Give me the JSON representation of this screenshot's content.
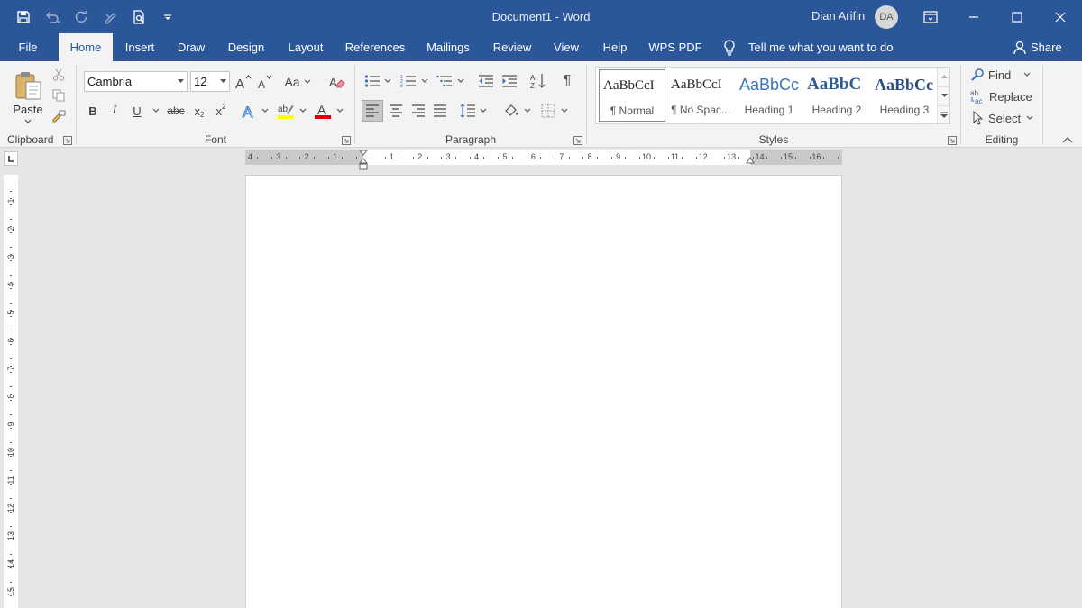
{
  "window": {
    "title": "Document1  -  Word",
    "user_name": "Dian Arifin",
    "user_initials": "DA"
  },
  "quick_access": [
    "save-icon",
    "undo-icon",
    "redo-icon",
    "touch-mode-icon",
    "print-preview-icon",
    "customize-qat-icon"
  ],
  "tabs": {
    "file": "File",
    "home": "Home",
    "insert": "Insert",
    "draw": "Draw",
    "design": "Design",
    "layout": "Layout",
    "references": "References",
    "mailings": "Mailings",
    "review": "Review",
    "view": "View",
    "help": "Help",
    "wps_pdf": "WPS PDF"
  },
  "tell_me": "Tell me what you want to do",
  "share": "Share",
  "clipboard": {
    "label": "Clipboard",
    "paste": "Paste"
  },
  "font": {
    "label": "Font",
    "name": "Cambria",
    "size": "12",
    "change_case": "Aa",
    "bold": "B",
    "italic": "I",
    "underline": "U",
    "strikethrough": "abc",
    "subscript": "x",
    "subscript_mark": "2",
    "superscript": "x",
    "superscript_mark": "2",
    "highlight_color": "#ffff00",
    "font_color": "#e00000"
  },
  "paragraph": {
    "label": "Paragraph",
    "pilcrow": "¶"
  },
  "styles": {
    "label": "Styles",
    "items": [
      {
        "sample": "AaBbCcI",
        "name": "¶ Normal"
      },
      {
        "sample": "AaBbCcI",
        "name": "¶ No Spac..."
      },
      {
        "sample": "AaBbCc",
        "name": "Heading 1"
      },
      {
        "sample": "AaBbC",
        "name": "Heading 2"
      },
      {
        "sample": "AaBbCc",
        "name": "Heading 3"
      }
    ]
  },
  "editing": {
    "label": "Editing",
    "find": "Find",
    "replace": "Replace",
    "select": "Select"
  },
  "ruler": {
    "h_left_numbers": [
      "4",
      "3",
      "2",
      "1"
    ],
    "h_right_numbers": [
      "1",
      "2",
      "3",
      "4",
      "5",
      "6",
      "7",
      "8",
      "9",
      "10",
      "11",
      "12",
      "13",
      "14",
      "15",
      "16"
    ],
    "v_numbers": [
      "1",
      "2",
      "3",
      "4",
      "5",
      "6",
      "7",
      "8",
      "9",
      "10",
      "11",
      "12",
      "13",
      "14",
      "15"
    ]
  },
  "colors": {
    "accent": "#2b579a",
    "ribbon_bg": "#f3f3f3",
    "workspace_bg": "#e6e6e6"
  }
}
